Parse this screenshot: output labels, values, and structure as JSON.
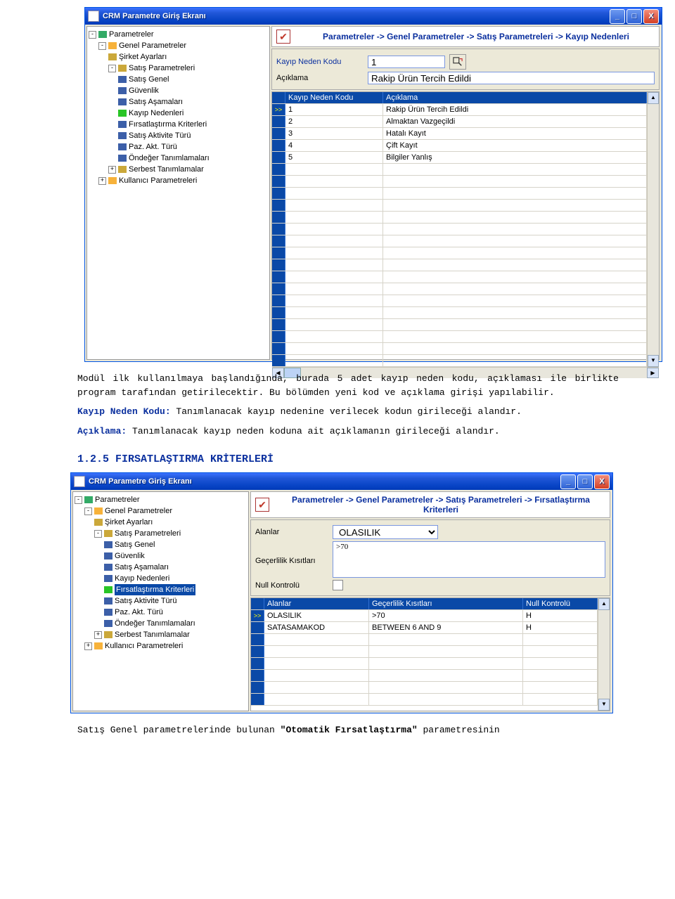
{
  "doc": {
    "para1": "Modül ilk kullanılmaya başlandığında, burada 5 adet kayıp neden kodu, açıklaması ile birlikte program tarafından getirilecektir. Bu bölümden yeni kod ve açıklama girişi yapılabilir.",
    "kayip_label": "Kayıp Neden Kodu:",
    "kayip_text": " Tanımlanacak kayıp nedenine verilecek kodun girileceği alandır.",
    "aciklama_label": "Açıklama:",
    "aciklama_text": " Tanımlanacak kayıp neden koduna ait açıklamanın girileceği alandır.",
    "section_heading": "1.2.5  FIRSATLAŞTIRMA KRİTERLERİ",
    "para2_a": "Satış Genel parametrelerinde bulunan ",
    "para2_b": "\"Otomatik Fırsatlaştırma\"",
    "para2_c": " parametresinin"
  },
  "win1": {
    "title": "CRM Parametre Giriş Ekranı",
    "tree": {
      "root": "Parametreler",
      "genel": "Genel Parametreler",
      "sirket": "Şirket Ayarları",
      "satis_param": "Satış Parametreleri",
      "satis_genel": "Satış Genel",
      "guvenlik": "Güvenlik",
      "satis_asama": "Satış Aşamaları",
      "kayip": "Kayıp Nedenleri",
      "firsat": "Fırsatlaştırma Kriterleri",
      "aktivite": "Satış Aktivite Türü",
      "paz": "Paz. Akt. Türü",
      "ondeger": "Öndeğer Tanımlamaları",
      "serbest": "Serbest Tanımlamalar",
      "kullanici": "Kullanıcı Parametreleri"
    },
    "breadcrumb": "Parametreler -> Genel Parametreler -> Satış Parametreleri -> Kayıp Nedenleri",
    "form": {
      "kod_label": "Kayıp Neden Kodu",
      "kod_value": "1",
      "aciklama_label": "Açıklama",
      "aciklama_value": "Rakip Ürün Tercih Edildi"
    },
    "grid": {
      "col1": "Kayıp Neden Kodu",
      "col2": "Açıklama",
      "rows": [
        {
          "k": "1",
          "a": "Rakip Ürün Tercih Edildi"
        },
        {
          "k": "2",
          "a": "Almaktan Vazgeçildi"
        },
        {
          "k": "3",
          "a": "Hatalı Kayıt"
        },
        {
          "k": "4",
          "a": "Çift Kayıt"
        },
        {
          "k": "5",
          "a": "Bilgiler Yanlış"
        }
      ]
    }
  },
  "win2": {
    "title": "CRM Parametre Giriş Ekranı",
    "breadcrumb": "Parametreler -> Genel Parametreler -> Satış Parametreleri -> Fırsatlaştırma Kriterleri",
    "form": {
      "alanlar_label": "Alanlar",
      "alanlar_value": "OLASILIK",
      "gecerlilik_label": "Geçerlilik Kısıtları",
      "gecerlilik_value": ">70",
      "null_label": "Null Kontrolü"
    },
    "grid": {
      "col1": "Alanlar",
      "col2": "Geçerlilik Kısıtları",
      "col3": "Null Kontrolü",
      "rows": [
        {
          "a": "OLASILIK",
          "g": ">70",
          "n": "H"
        },
        {
          "a": "SATASAMAKOD",
          "g": "BETWEEN 6 AND 9",
          "n": "H"
        }
      ]
    }
  }
}
